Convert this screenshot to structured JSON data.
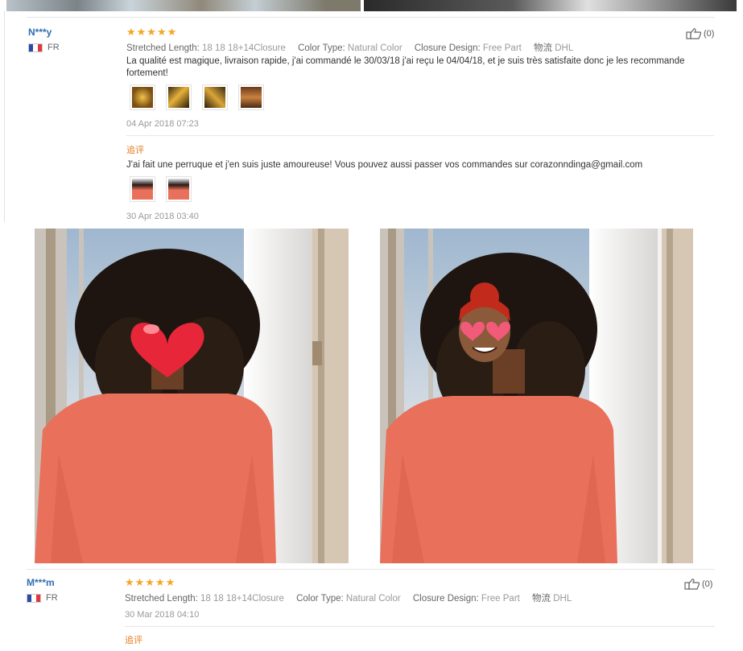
{
  "review1": {
    "name": "N***y",
    "country": "FR",
    "stars": "★★★★★",
    "attrs": [
      {
        "k": "Stretched Length:",
        "v": "18 18 18+14Closure"
      },
      {
        "k": "Color Type:",
        "v": "Natural Color"
      },
      {
        "k": "Closure Design:",
        "v": "Free Part"
      },
      {
        "k": "物流",
        "v": "DHL"
      }
    ],
    "text": "La qualité est magique, livraison rapide, j'ai commandé le 30/03/18 j'ai reçu le 04/04/18, et je suis très satisfaite donc je les recommande fortement!",
    "date": "04 Apr 2018 07:23",
    "helpful": "(0)",
    "followup": {
      "label": "追评",
      "text": "J'ai fait une perruque et j'en suis juste amoureuse! Vous pouvez aussi passer vos commandes sur corazonndinga@gmail.com",
      "date": "30 Apr 2018 03:40"
    }
  },
  "review2": {
    "name": "M***m",
    "country": "FR",
    "stars": "★★★★★",
    "attrs": [
      {
        "k": "Stretched Length:",
        "v": "18 18 18+14Closure"
      },
      {
        "k": "Color Type:",
        "v": "Natural Color"
      },
      {
        "k": "Closure Design:",
        "v": "Free Part"
      },
      {
        "k": "物流",
        "v": "DHL"
      }
    ],
    "date": "30 Mar 2018 04:10",
    "helpful": "(0)",
    "followup_label": "追评"
  },
  "colors": {
    "name": "#2f6fb0",
    "stars": "#f5a623",
    "followup": "#e67e22",
    "blouse": "#e9705a"
  }
}
